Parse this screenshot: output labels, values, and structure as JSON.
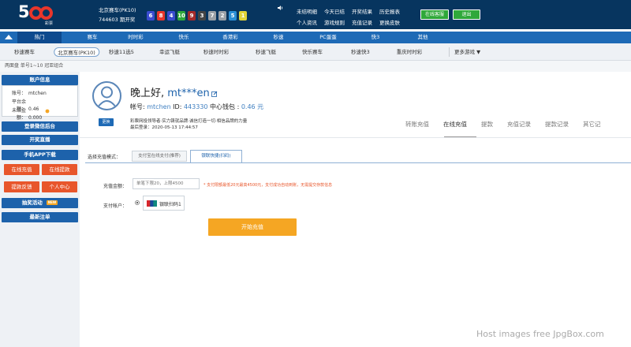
{
  "header": {
    "logo_text": "5",
    "logo_tag": "彩票",
    "lottery_name": "北京赛车(PK10)",
    "issue_text": "744603 期开奖",
    "balls": [
      {
        "n": "6",
        "color": "#3a4ccf"
      },
      {
        "n": "8",
        "color": "#e8362b"
      },
      {
        "n": "4",
        "color": "#3a4ccf"
      },
      {
        "n": "10",
        "color": "#2fa83a"
      },
      {
        "n": "9",
        "color": "#a52a2a"
      },
      {
        "n": "3",
        "color": "#444444"
      },
      {
        "n": "7",
        "color": "#9aa0a6"
      },
      {
        "n": "2",
        "color": "#9aa0a6"
      },
      {
        "n": "5",
        "color": "#2b8fd6"
      },
      {
        "n": "1",
        "color": "#e2d438"
      }
    ],
    "links": [
      "未结明细",
      "今天已结",
      "开奖结果",
      "历史报表",
      "个人资讯",
      "游戏规则",
      "充值记录",
      "更换皮肤"
    ],
    "online_service": "在线客服",
    "logout": "退出"
  },
  "nav": {
    "items": [
      "热门",
      "赛车",
      "时时彩",
      "快乐",
      "香港彩",
      "秒速",
      "PC蛋蛋",
      "快3",
      "其他"
    ]
  },
  "subnav": {
    "items": [
      "秒速赛车",
      "北京赛车(PK10)",
      "秒速11选5",
      "幸运飞艇",
      "秒速时时彩",
      "秒速飞艇",
      "快乐赛车",
      "秒速快3",
      "重庆时时彩"
    ],
    "active_index": 1,
    "more": "更多游戏 ▼"
  },
  "breadcrumb": "两面盘   单号1~10   冠亚组合",
  "sidebar": {
    "account_title": "账户信息",
    "account": {
      "label": "账号：",
      "value": "mtchen"
    },
    "pending": {
      "label": "平台余额：",
      "value": "0.46"
    },
    "unsettled": {
      "label": "未结金额：",
      "value": "0.000"
    },
    "login_backend": "登录微信后台",
    "live": "开奖直播",
    "app": "手机APP下载",
    "btn_recharge": "在线充值",
    "btn_withdraw": "在线提款",
    "btn_feedback": "提款反馈",
    "btn_center": "个人中心",
    "promo": "抽奖活动",
    "promo_badge": "NEW",
    "recent": "最新注单"
  },
  "profile": {
    "greeting": "晚上好, ",
    "user": "mt***en",
    "change_avatar": "更换",
    "acct_label": "帐号: ",
    "acct_value": "mtchen",
    "id_label": "  ID: ",
    "id_value": "443330",
    "wallet_label": "  中心钱包 : ",
    "wallet_value": "0.46 元",
    "slogan": "彩票网投领导者·实力铸就品牌·诚信打造一切·相信品牌的力量",
    "last_login": "最后登录：2020-05-13 17:44:57"
  },
  "tabs": {
    "items": [
      "转账充值",
      "在线充值",
      "提款",
      "充值记录",
      "提款记录",
      "其它记"
    ],
    "active_index": 1
  },
  "recharge": {
    "method_label": "选择充值模式：",
    "method_tabs": [
      "支付宝在线支付(推荐)",
      "银联快捷(扫码)"
    ],
    "amount_label": "充值金额：",
    "amount_placeholder": "单笔下限20，上限4500",
    "amount_note": "* 支付限额最低20元最高4500元，支付成功自动到账，无需提交存款信息",
    "pay_account_label": "支付帐户：",
    "pay_option": "银联扫码1",
    "submit": "开始充值"
  },
  "watermark": "Host images free JpgBox.com"
}
